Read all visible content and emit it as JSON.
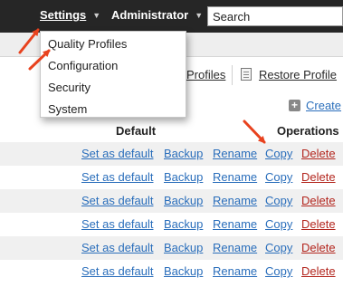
{
  "nav": {
    "settings_label": "Settings",
    "administrator_label": "Administrator",
    "search_placeholder": "Search"
  },
  "settings_menu": {
    "items": [
      "Quality Profiles",
      "Configuration",
      "Security",
      "System"
    ]
  },
  "toolbar": {
    "profiles_link": "Profiles",
    "restore_profile_link": "Restore Profile",
    "restore_icon": "document-icon"
  },
  "create": {
    "label": "Create",
    "icon": "plus-icon"
  },
  "table": {
    "headers": {
      "default": "Default",
      "operations": "Operations"
    },
    "rows": [
      {
        "set_default": "Set as default",
        "backup": "Backup",
        "rename": "Rename",
        "copy": "Copy",
        "delete": "Delete"
      },
      {
        "set_default": "Set as default",
        "backup": "Backup",
        "rename": "Rename",
        "copy": "Copy",
        "delete": "Delete"
      },
      {
        "set_default": "Set as default",
        "backup": "Backup",
        "rename": "Rename",
        "copy": "Copy",
        "delete": "Delete"
      },
      {
        "set_default": "Set as default",
        "backup": "Backup",
        "rename": "Rename",
        "copy": "Copy",
        "delete": "Delete"
      },
      {
        "set_default": "Set as default",
        "backup": "Backup",
        "rename": "Rename",
        "copy": "Copy",
        "delete": "Delete"
      },
      {
        "set_default": "Set as default",
        "backup": "Backup",
        "rename": "Rename",
        "copy": "Copy",
        "delete": "Delete"
      }
    ]
  },
  "colors": {
    "topbar": "#262626",
    "link": "#2a6ebb",
    "delete": "#b3261e",
    "annotation_arrow": "#e8421e",
    "row_alt": "#f0f0f0"
  }
}
